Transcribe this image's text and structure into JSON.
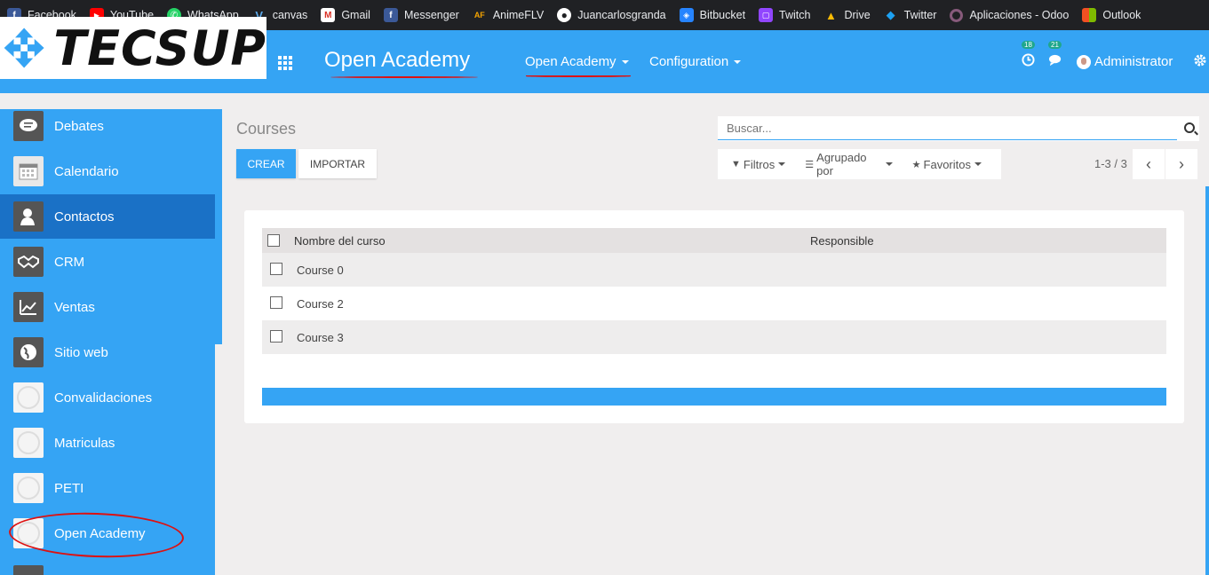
{
  "bookmarks": [
    {
      "label": "Facebook",
      "icon": "facebook-icon",
      "color": "#3b5998",
      "glyph": "f"
    },
    {
      "label": "YouTube",
      "icon": "youtube-icon",
      "color": "#ff0000",
      "glyph": "▶"
    },
    {
      "label": "WhatsApp",
      "icon": "whatsapp-icon",
      "color": "#25d366",
      "glyph": "✆"
    },
    {
      "label": "canvas",
      "icon": "canvas-icon",
      "color": "#202124",
      "glyph": "V"
    },
    {
      "label": "Gmail",
      "icon": "gmail-icon",
      "color": "#ffffff",
      "glyph": "M"
    },
    {
      "label": "Messenger",
      "icon": "messenger-icon",
      "color": "#3b5998",
      "glyph": "f"
    },
    {
      "label": "AnimeFLV",
      "icon": "animeflv-icon",
      "color": "#202124",
      "glyph": "AF"
    },
    {
      "label": "Juancarlosgranda",
      "icon": "github-icon",
      "color": "#202124",
      "glyph": "●"
    },
    {
      "label": "Bitbucket",
      "icon": "bitbucket-icon",
      "color": "#2684ff",
      "glyph": "◈"
    },
    {
      "label": "Twitch",
      "icon": "twitch-icon",
      "color": "#9146ff",
      "glyph": "▢"
    },
    {
      "label": "Drive",
      "icon": "drive-icon",
      "color": "#202124",
      "glyph": "▲"
    },
    {
      "label": "Twitter",
      "icon": "twitter-icon",
      "color": "#202124",
      "glyph": "🐦"
    },
    {
      "label": "Aplicaciones - Odoo",
      "icon": "odoo-icon",
      "color": "#202124",
      "glyph": "○"
    },
    {
      "label": "Outlook",
      "icon": "outlook-icon",
      "color": "#202124",
      "glyph": "▦"
    }
  ],
  "logo": {
    "text": "TECSUP"
  },
  "navbar": {
    "brand": "Open Academy",
    "menu": [
      "Open Academy",
      "Configuration"
    ],
    "activities_count": "18",
    "messages_count": "21",
    "user": "Administrator"
  },
  "sidebar": {
    "items": [
      {
        "label": "Debates",
        "icon": "chat-icon"
      },
      {
        "label": "Calendario",
        "icon": "calendar-icon"
      },
      {
        "label": "Contactos",
        "icon": "contacts-icon",
        "active": true
      },
      {
        "label": "CRM",
        "icon": "handshake-icon"
      },
      {
        "label": "Ventas",
        "icon": "chart-icon"
      },
      {
        "label": "Sitio web",
        "icon": "globe-icon"
      },
      {
        "label": "Convalidaciones",
        "icon": "placeholder-icon"
      },
      {
        "label": "Matriculas",
        "icon": "placeholder-icon"
      },
      {
        "label": "PETI",
        "icon": "placeholder-icon"
      },
      {
        "label": "Open Academy",
        "icon": "placeholder-icon"
      }
    ]
  },
  "page": {
    "title": "Courses",
    "create_label": "CREAR",
    "import_label": "IMPORTAR",
    "search_placeholder": "Buscar...",
    "filters_label": "Filtros",
    "groupby_label": "Agrupado por",
    "favorites_label": "Favoritos",
    "pager": "1-3 / 3"
  },
  "table": {
    "columns": [
      "Nombre del curso",
      "Responsible"
    ],
    "rows": [
      {
        "name": "Course 0",
        "responsible": ""
      },
      {
        "name": "Course 2",
        "responsible": ""
      },
      {
        "name": "Course 3",
        "responsible": ""
      }
    ]
  },
  "colors": {
    "primary": "#35a4f4",
    "active": "#1a71c6",
    "annotation": "#dd1111"
  }
}
